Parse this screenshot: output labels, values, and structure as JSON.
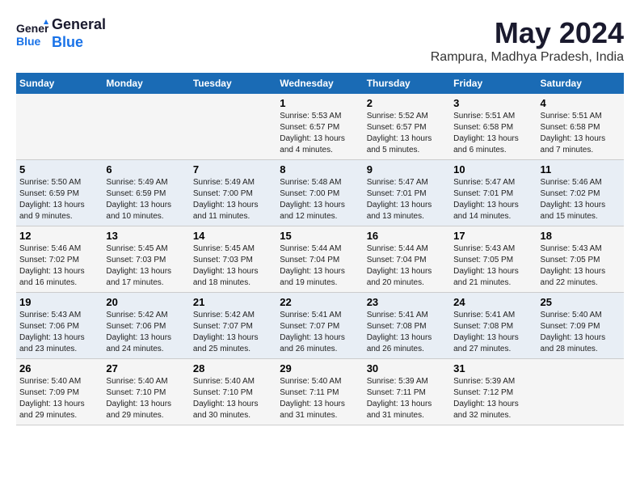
{
  "header": {
    "logo_line1": "General",
    "logo_line2": "Blue",
    "main_title": "May 2024",
    "subtitle": "Rampura, Madhya Pradesh, India"
  },
  "days_of_week": [
    "Sunday",
    "Monday",
    "Tuesday",
    "Wednesday",
    "Thursday",
    "Friday",
    "Saturday"
  ],
  "weeks": [
    [
      {
        "day": "",
        "sunrise": "",
        "sunset": "",
        "daylight": ""
      },
      {
        "day": "",
        "sunrise": "",
        "sunset": "",
        "daylight": ""
      },
      {
        "day": "",
        "sunrise": "",
        "sunset": "",
        "daylight": ""
      },
      {
        "day": "1",
        "sunrise": "Sunrise: 5:53 AM",
        "sunset": "Sunset: 6:57 PM",
        "daylight": "Daylight: 13 hours and 4 minutes."
      },
      {
        "day": "2",
        "sunrise": "Sunrise: 5:52 AM",
        "sunset": "Sunset: 6:57 PM",
        "daylight": "Daylight: 13 hours and 5 minutes."
      },
      {
        "day": "3",
        "sunrise": "Sunrise: 5:51 AM",
        "sunset": "Sunset: 6:58 PM",
        "daylight": "Daylight: 13 hours and 6 minutes."
      },
      {
        "day": "4",
        "sunrise": "Sunrise: 5:51 AM",
        "sunset": "Sunset: 6:58 PM",
        "daylight": "Daylight: 13 hours and 7 minutes."
      }
    ],
    [
      {
        "day": "5",
        "sunrise": "Sunrise: 5:50 AM",
        "sunset": "Sunset: 6:59 PM",
        "daylight": "Daylight: 13 hours and 9 minutes."
      },
      {
        "day": "6",
        "sunrise": "Sunrise: 5:49 AM",
        "sunset": "Sunset: 6:59 PM",
        "daylight": "Daylight: 13 hours and 10 minutes."
      },
      {
        "day": "7",
        "sunrise": "Sunrise: 5:49 AM",
        "sunset": "Sunset: 7:00 PM",
        "daylight": "Daylight: 13 hours and 11 minutes."
      },
      {
        "day": "8",
        "sunrise": "Sunrise: 5:48 AM",
        "sunset": "Sunset: 7:00 PM",
        "daylight": "Daylight: 13 hours and 12 minutes."
      },
      {
        "day": "9",
        "sunrise": "Sunrise: 5:47 AM",
        "sunset": "Sunset: 7:01 PM",
        "daylight": "Daylight: 13 hours and 13 minutes."
      },
      {
        "day": "10",
        "sunrise": "Sunrise: 5:47 AM",
        "sunset": "Sunset: 7:01 PM",
        "daylight": "Daylight: 13 hours and 14 minutes."
      },
      {
        "day": "11",
        "sunrise": "Sunrise: 5:46 AM",
        "sunset": "Sunset: 7:02 PM",
        "daylight": "Daylight: 13 hours and 15 minutes."
      }
    ],
    [
      {
        "day": "12",
        "sunrise": "Sunrise: 5:46 AM",
        "sunset": "Sunset: 7:02 PM",
        "daylight": "Daylight: 13 hours and 16 minutes."
      },
      {
        "day": "13",
        "sunrise": "Sunrise: 5:45 AM",
        "sunset": "Sunset: 7:03 PM",
        "daylight": "Daylight: 13 hours and 17 minutes."
      },
      {
        "day": "14",
        "sunrise": "Sunrise: 5:45 AM",
        "sunset": "Sunset: 7:03 PM",
        "daylight": "Daylight: 13 hours and 18 minutes."
      },
      {
        "day": "15",
        "sunrise": "Sunrise: 5:44 AM",
        "sunset": "Sunset: 7:04 PM",
        "daylight": "Daylight: 13 hours and 19 minutes."
      },
      {
        "day": "16",
        "sunrise": "Sunrise: 5:44 AM",
        "sunset": "Sunset: 7:04 PM",
        "daylight": "Daylight: 13 hours and 20 minutes."
      },
      {
        "day": "17",
        "sunrise": "Sunrise: 5:43 AM",
        "sunset": "Sunset: 7:05 PM",
        "daylight": "Daylight: 13 hours and 21 minutes."
      },
      {
        "day": "18",
        "sunrise": "Sunrise: 5:43 AM",
        "sunset": "Sunset: 7:05 PM",
        "daylight": "Daylight: 13 hours and 22 minutes."
      }
    ],
    [
      {
        "day": "19",
        "sunrise": "Sunrise: 5:43 AM",
        "sunset": "Sunset: 7:06 PM",
        "daylight": "Daylight: 13 hours and 23 minutes."
      },
      {
        "day": "20",
        "sunrise": "Sunrise: 5:42 AM",
        "sunset": "Sunset: 7:06 PM",
        "daylight": "Daylight: 13 hours and 24 minutes."
      },
      {
        "day": "21",
        "sunrise": "Sunrise: 5:42 AM",
        "sunset": "Sunset: 7:07 PM",
        "daylight": "Daylight: 13 hours and 25 minutes."
      },
      {
        "day": "22",
        "sunrise": "Sunrise: 5:41 AM",
        "sunset": "Sunset: 7:07 PM",
        "daylight": "Daylight: 13 hours and 26 minutes."
      },
      {
        "day": "23",
        "sunrise": "Sunrise: 5:41 AM",
        "sunset": "Sunset: 7:08 PM",
        "daylight": "Daylight: 13 hours and 26 minutes."
      },
      {
        "day": "24",
        "sunrise": "Sunrise: 5:41 AM",
        "sunset": "Sunset: 7:08 PM",
        "daylight": "Daylight: 13 hours and 27 minutes."
      },
      {
        "day": "25",
        "sunrise": "Sunrise: 5:40 AM",
        "sunset": "Sunset: 7:09 PM",
        "daylight": "Daylight: 13 hours and 28 minutes."
      }
    ],
    [
      {
        "day": "26",
        "sunrise": "Sunrise: 5:40 AM",
        "sunset": "Sunset: 7:09 PM",
        "daylight": "Daylight: 13 hours and 29 minutes."
      },
      {
        "day": "27",
        "sunrise": "Sunrise: 5:40 AM",
        "sunset": "Sunset: 7:10 PM",
        "daylight": "Daylight: 13 hours and 29 minutes."
      },
      {
        "day": "28",
        "sunrise": "Sunrise: 5:40 AM",
        "sunset": "Sunset: 7:10 PM",
        "daylight": "Daylight: 13 hours and 30 minutes."
      },
      {
        "day": "29",
        "sunrise": "Sunrise: 5:40 AM",
        "sunset": "Sunset: 7:11 PM",
        "daylight": "Daylight: 13 hours and 31 minutes."
      },
      {
        "day": "30",
        "sunrise": "Sunrise: 5:39 AM",
        "sunset": "Sunset: 7:11 PM",
        "daylight": "Daylight: 13 hours and 31 minutes."
      },
      {
        "day": "31",
        "sunrise": "Sunrise: 5:39 AM",
        "sunset": "Sunset: 7:12 PM",
        "daylight": "Daylight: 13 hours and 32 minutes."
      },
      {
        "day": "",
        "sunrise": "",
        "sunset": "",
        "daylight": ""
      }
    ]
  ]
}
